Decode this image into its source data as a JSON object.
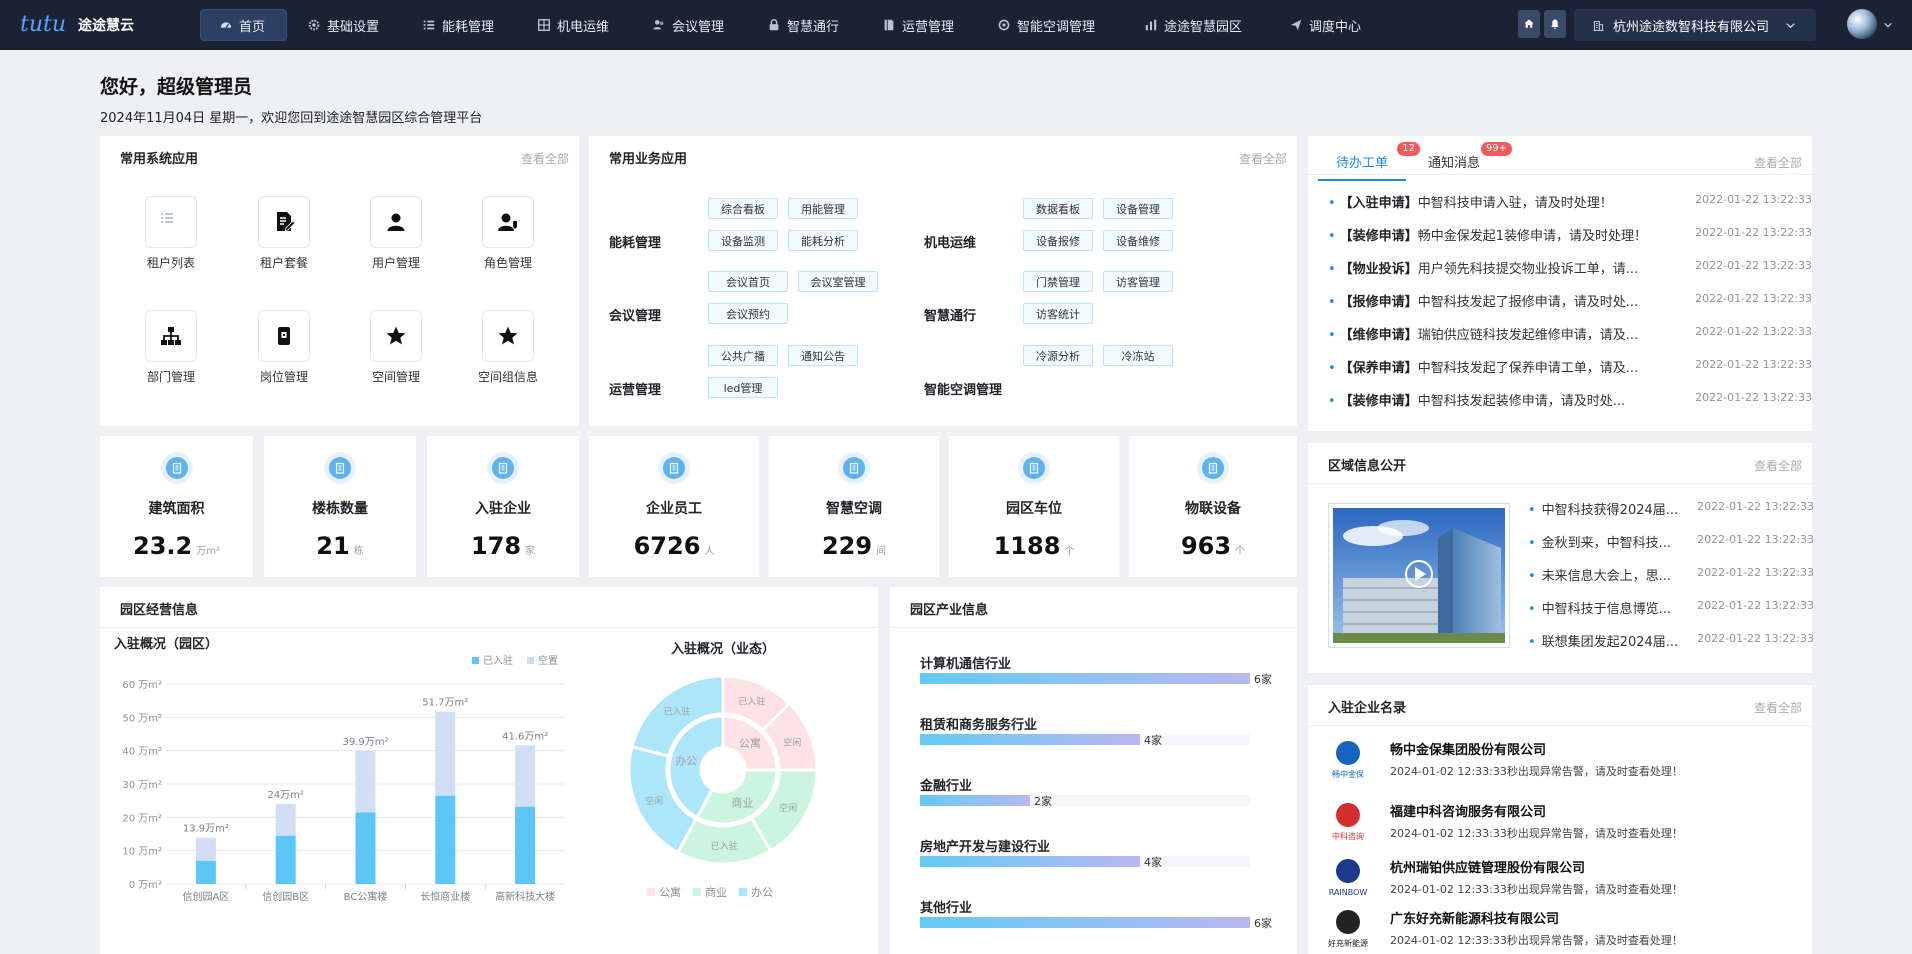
{
  "topbar": {
    "logo_mark": "tutu",
    "app_name": "途途慧云",
    "nav": [
      {
        "label": "首页",
        "icon": "dashboard-icon",
        "active": true
      },
      {
        "label": "基础设置",
        "icon": "gear-icon"
      },
      {
        "label": "能耗管理",
        "icon": "list-icon"
      },
      {
        "label": "机电运维",
        "icon": "grid-icon"
      },
      {
        "label": "会议管理",
        "icon": "people-icon"
      },
      {
        "label": "智慧通行",
        "icon": "lock-icon"
      },
      {
        "label": "运营管理",
        "icon": "book-icon"
      },
      {
        "label": "智能空调管理",
        "icon": "snowflake-icon"
      },
      {
        "label": "途途智慧园区",
        "icon": "bar-chart-icon"
      },
      {
        "label": "调度中心",
        "icon": "send-icon"
      }
    ],
    "company": "杭州途途数智科技有限公司"
  },
  "greeting": {
    "title": "您好，超级管理员",
    "subtitle": "2024年11月04日 星期一，欢迎您回到途途智慧园区综合管理平台"
  },
  "sys_apps": {
    "title": "常用系统应用",
    "more": "查看全部",
    "items": [
      {
        "label": "租户列表",
        "icon": "list-icon"
      },
      {
        "label": "租户套餐",
        "icon": "document-edit-icon"
      },
      {
        "label": "用户管理",
        "icon": "user-icon"
      },
      {
        "label": "角色管理",
        "icon": "user-role-icon"
      },
      {
        "label": "部门管理",
        "icon": "org-chart-icon"
      },
      {
        "label": "岗位管理",
        "icon": "id-card-icon"
      },
      {
        "label": "空间管理",
        "icon": "star-icon"
      },
      {
        "label": "空间组信息",
        "icon": "star-icon"
      }
    ]
  },
  "biz_apps": {
    "title": "常用业务应用",
    "more": "查看全部",
    "groups": [
      {
        "name": "能耗管理",
        "tags": [
          "综合看板",
          "用能管理",
          "设备监测",
          "能耗分析"
        ]
      },
      {
        "name": "机电运维",
        "tags": [
          "数据看板",
          "设备管理",
          "设备报修",
          "设备维修"
        ]
      },
      {
        "name": "会议管理",
        "tags": [
          "会议首页",
          "会议室管理",
          "会议预约"
        ]
      },
      {
        "name": "智慧通行",
        "tags": [
          "门禁管理",
          "访客管理",
          "访客统计"
        ]
      },
      {
        "name": "运营管理",
        "tags": [
          "公共广播",
          "通知公告",
          "led管理"
        ]
      },
      {
        "name": "智能空调管理",
        "tags": [
          "冷源分析",
          "冷冻站"
        ]
      }
    ]
  },
  "todo": {
    "tabs": [
      {
        "label": "待办工单",
        "badge": "12"
      },
      {
        "label": "通知消息",
        "badge": "99+"
      }
    ],
    "more": "查看全部",
    "items": [
      {
        "type": "【入驻申请】",
        "text": "中智科技申请入驻，请及时处理！",
        "time": "2022-01-22 13:22:33"
      },
      {
        "type": "【装修申请】",
        "text": "畅中金保发起1装修申请，请及时处理！",
        "time": "2022-01-22 13:22:33"
      },
      {
        "type": "【物业投诉】",
        "text": "用户领先科技提交物业投诉工单，请...",
        "time": "2022-01-22 13:22:33"
      },
      {
        "type": "【报修申请】",
        "text": "中智科技发起了报修申请，请及时处...",
        "time": "2022-01-22 13:22:33"
      },
      {
        "type": "【维修申请】",
        "text": "瑞铂供应链科技发起维修申请，请及...",
        "time": "2022-01-22 13:22:33"
      },
      {
        "type": "【保养申请】",
        "text": "中智科技发起了保养申请工单，请及...",
        "time": "2022-01-22 13:22:33"
      },
      {
        "type": "【装修申请】",
        "text": "中智科技发起装修申请，请及时处...",
        "time": "2022-01-22 13:22:33"
      }
    ]
  },
  "stats": [
    {
      "label": "建筑面积",
      "value": "23.2",
      "unit": "万m²"
    },
    {
      "label": "楼栋数量",
      "value": "21",
      "unit": "栋"
    },
    {
      "label": "入驻企业",
      "value": "178",
      "unit": "家"
    },
    {
      "label": "企业员工",
      "value": "6726",
      "unit": "人"
    },
    {
      "label": "智慧空调",
      "value": "229",
      "unit": "间"
    },
    {
      "label": "园区车位",
      "value": "1188",
      "unit": "个"
    },
    {
      "label": "物联设备",
      "value": "963",
      "unit": "个"
    }
  ],
  "operations": {
    "title": "园区经营信息"
  },
  "chart_data": [
    {
      "type": "bar",
      "title": "入驻概况（园区）",
      "categories": [
        "信创园A区",
        "信创园B区",
        "BC公寓楼",
        "长恒商业楼",
        "高新科技大楼"
      ],
      "series": [
        {
          "name": "已入驻",
          "values": [
            7,
            14.5,
            21.5,
            26.5,
            23.2
          ]
        },
        {
          "name": "空置",
          "values": [
            6.9,
            9.5,
            18.4,
            25.2,
            18.4
          ]
        }
      ],
      "total_labels": [
        "13.9万m²",
        "24万m²",
        "39.9万m²",
        "51.7万m²",
        "41.6万m²"
      ],
      "yticks": [
        "0 万m²",
        "10 万m²",
        "20 万m²",
        "30 万m²",
        "40 万m²",
        "50 万m²",
        "60 万m²"
      ],
      "ylim": [
        0,
        60
      ],
      "stacked": true,
      "grid": true,
      "legend": "top-right",
      "colors": [
        "#5cc6f6",
        "#d2def6"
      ]
    },
    {
      "type": "pie",
      "title": "入驻概况（业态）",
      "legend_labels": [
        "公寓",
        "商业",
        "办公"
      ],
      "inner": [
        {
          "label": "公寓",
          "value": 25,
          "color": "#fde3e6"
        },
        {
          "label": "商业",
          "value": 33,
          "color": "#ccf5e0"
        },
        {
          "label": "办公",
          "value": 42,
          "color": "#ade6fb"
        }
      ],
      "outer": [
        {
          "label": "已入驻",
          "group": "公寓",
          "value": 12.5,
          "color": "#fde3e6"
        },
        {
          "label": "空闲",
          "group": "公寓",
          "value": 12.5,
          "color": "#fde3e6"
        },
        {
          "label": "空闲",
          "group": "商业",
          "value": 16.5,
          "color": "#ccf5e0"
        },
        {
          "label": "已入驻",
          "group": "商业",
          "value": 16.5,
          "color": "#ccf5e0"
        },
        {
          "label": "空闲",
          "group": "办公",
          "value": 21,
          "color": "#ade6fb"
        },
        {
          "label": "已入驻",
          "group": "办公",
          "value": 21,
          "color": "#ade6fb"
        }
      ]
    },
    {
      "type": "bar",
      "title": "园区产业信息",
      "orientation": "horizontal",
      "categories": [
        "计算机通信行业",
        "租赁和商务服务行业",
        "金融行业",
        "房地产开发与建设行业",
        "其他行业"
      ],
      "values": [
        6,
        4,
        2,
        4,
        6
      ],
      "value_labels": [
        "6家",
        "4家",
        "2家",
        "4家",
        "6家"
      ],
      "xlim": [
        0,
        6
      ]
    }
  ],
  "region": {
    "title": "区域信息公开",
    "more": "查看全部",
    "news": [
      {
        "text": "中智科技获得2024届...",
        "time": "2022-01-22 13:22:33"
      },
      {
        "text": "金秋到来，中智科技...",
        "time": "2022-01-22 13:22:33"
      },
      {
        "text": "未来信息大会上，思...",
        "time": "2022-01-22 13:22:33"
      },
      {
        "text": "中智科技于信息博览...",
        "time": "2022-01-22 13:22:33"
      },
      {
        "text": "联想集团发起2024届...",
        "time": "2022-01-22 13:22:33"
      }
    ]
  },
  "enterprises": {
    "title": "入驻企业名录",
    "more": "查看全部",
    "items": [
      {
        "name": "畅中金保集团股份有限公司",
        "desc": "2024-01-02 12:33:33秒出现异常告警，请及时查看处理！",
        "logo_text": "畅中金保",
        "logo_color": "#1565c0"
      },
      {
        "name": "福建中科咨询服务有限公司",
        "desc": "2024-01-02 12:33:33秒出现异常告警，请及时查看处理！",
        "logo_text": "中科咨询",
        "logo_color": "#d32f2f"
      },
      {
        "name": "杭州瑞铂供应链管理股份有限公司",
        "desc": "2024-01-02 12:33:33秒出现异常告警，请及时查看处理！",
        "logo_text": "RAINBOW",
        "logo_color": "#1e3a8a"
      },
      {
        "name": "广东好充新能源科技有限公司",
        "desc": "2024-01-02 12:33:33秒出现异常告警，请及时查看处理！",
        "logo_text": "好充新能源",
        "logo_color": "#222222"
      }
    ]
  }
}
